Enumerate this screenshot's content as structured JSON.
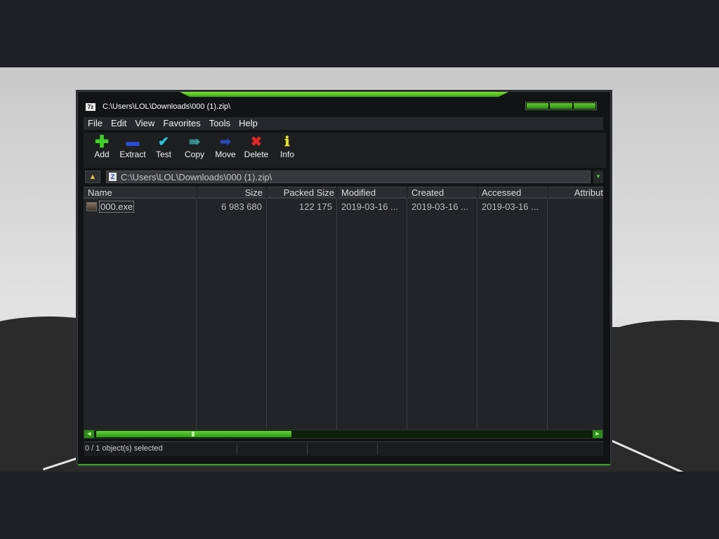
{
  "window": {
    "title": "C:\\Users\\LOL\\Downloads\\000 (1).zip\\",
    "app_icon_text": "7z"
  },
  "menu": [
    "File",
    "Edit",
    "View",
    "Favorites",
    "Tools",
    "Help"
  ],
  "toolbar": [
    {
      "label": "Add",
      "icon": "plus-icon"
    },
    {
      "label": "Extract",
      "icon": "minus-icon"
    },
    {
      "label": "Test",
      "icon": "checkmark-icon"
    },
    {
      "label": "Copy",
      "icon": "double-arrow-icon"
    },
    {
      "label": "Move",
      "icon": "arrow-right-icon"
    },
    {
      "label": "Delete",
      "icon": "x-icon"
    },
    {
      "label": "Info",
      "icon": "info-icon"
    }
  ],
  "address": {
    "path": "C:\\Users\\LOL\\Downloads\\000 (1).zip\\",
    "icon_text": "Z"
  },
  "columns": [
    "Name",
    "Size",
    "Packed Size",
    "Modified",
    "Created",
    "Accessed",
    "Attribut"
  ],
  "files": [
    {
      "name": "000.exe",
      "size": "6 983 680",
      "packed_size": "122 175",
      "modified": "2019-03-16 ...",
      "created": "2019-03-16 ...",
      "accessed": "2019-03-16 ..."
    }
  ],
  "status": {
    "selection": "0 / 1 object(s) selected"
  },
  "colors": {
    "accent_green": "#3fb81a",
    "window_bg": "#121315",
    "list_bg": "#222427"
  }
}
